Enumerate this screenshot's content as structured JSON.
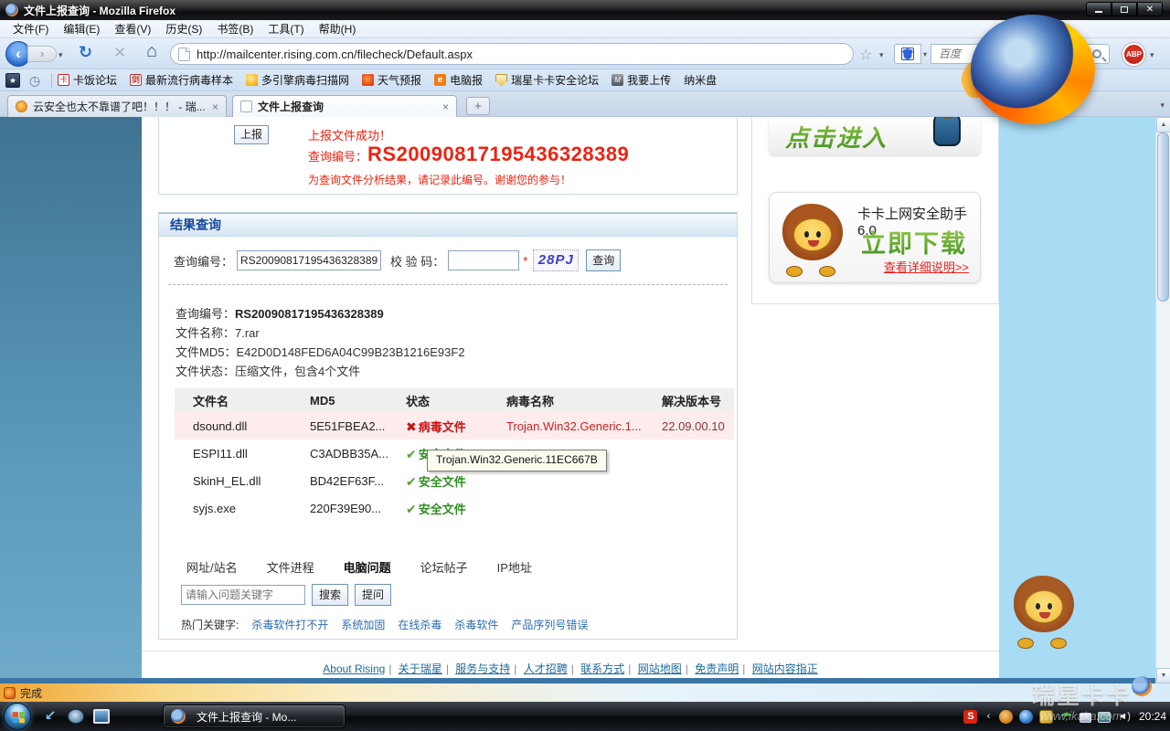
{
  "window": {
    "title": "文件上报查询 - Mozilla Firefox"
  },
  "menu": {
    "items": [
      "文件(F)",
      "编辑(E)",
      "查看(V)",
      "历史(S)",
      "书签(B)",
      "工具(T)",
      "帮助(H)"
    ]
  },
  "nav": {
    "url": "http://mailcenter.rising.com.cn/filecheck/Default.aspx",
    "search_placeholder": "百度",
    "adblock_label": "ABP"
  },
  "bookmarks": {
    "items": [
      "卡饭论坛",
      "最新流行病毒样本",
      "多引擎病毒扫描网",
      "天气预报",
      "电脑报",
      "瑞星卡卡安全论坛",
      "我要上传",
      "纳米盘"
    ]
  },
  "tabs": [
    {
      "label": "云安全也太不靠谱了吧！！！ - 瑞..."
    },
    {
      "label": "文件上报查询"
    }
  ],
  "report": {
    "button": "上报",
    "success": "上报文件成功！",
    "query_label": "查询编号：",
    "query_number": "RS20090817195436328389",
    "note": "为查询文件分析结果，请记录此编号。谢谢您的参与！"
  },
  "result": {
    "section_title": "结果查询",
    "query_label": "查询编号：",
    "query_value": "RS20090817195436328389",
    "captcha_label": "校 验 码：",
    "captcha_required": "*",
    "captcha_code": "28PJ",
    "query_button": "查询",
    "file_info": [
      {
        "label": "查询编号：",
        "value": "RS20090817195436328389"
      },
      {
        "label": "文件名称：",
        "value": "7.rar"
      },
      {
        "label": "文件MD5：",
        "value": "E42D0D148FED6A04C99B23B1216E93F2"
      },
      {
        "label": "文件状态：",
        "value": "压缩文件，包含4个文件"
      }
    ],
    "table": {
      "headers": [
        "文件名",
        "MD5",
        "状态",
        "病毒名称",
        "解决版本号"
      ],
      "rows": [
        {
          "file": "dsound.dll",
          "md5": "5E51FBEA2...",
          "status": "病毒文件",
          "virus": "Trojan.Win32.Generic.1...",
          "version": "22.09.00.10"
        },
        {
          "file": "ESPI11.dll",
          "md5": "C3ADBB35A...",
          "status": "安全文件",
          "virus": "",
          "version": ""
        },
        {
          "file": "SkinH_EL.dll",
          "md5": "BD42EF63F...",
          "status": "安全文件",
          "virus": "",
          "version": ""
        },
        {
          "file": "syjs.exe",
          "md5": "220F39E90...",
          "status": "安全文件",
          "virus": "",
          "version": ""
        }
      ]
    },
    "tooltip": "Trojan.Win32.Generic.11EC667B"
  },
  "help": {
    "tabs": [
      "网址/站名",
      "文件进程",
      "电脑问题",
      "论坛帖子",
      "IP地址"
    ],
    "search_placeholder": "请输入问题关键字",
    "search_button": "搜索",
    "ask_button": "提问",
    "hot_label": "热门关键字:",
    "hot_keywords": [
      "杀毒软件打不开",
      "系统加固",
      "在线杀毒",
      "杀毒软件",
      "产品序列号错误"
    ]
  },
  "sidebar": {
    "banner1_text": "点击进入",
    "banner2_title": "卡卡上网安全助手6.0",
    "banner2_download": "立即下载",
    "banner2_detail": "查看详细说明>>"
  },
  "footer": {
    "links": [
      "About Rising",
      "关于瑞星",
      "服务与支持",
      "人才招聘",
      "联系方式",
      "网站地图",
      "免责声明",
      "网站内容指正"
    ]
  },
  "statusbar": {
    "text": "完成"
  },
  "taskbar": {
    "task": "文件上报查询 - Mo...",
    "clock": "20:24"
  },
  "watermark": {
    "line1": "瑞星卡卡",
    "line2": "www.ikaka.com"
  },
  "icons": {
    "back": "‹",
    "forward": "›",
    "refresh": "↻",
    "stop": "✕",
    "home": "⌂",
    "star": "☆",
    "caret": "▾",
    "new_tab": "+",
    "close_tab": "×",
    "all_tabs": "▾",
    "panel": "★",
    "clock": "◷",
    "virus_mark": "✖",
    "safe_mark": "✔",
    "scroll_up": "▲",
    "scroll_down": "▼",
    "tray_expand": "‹",
    "sogou": "S",
    "umbrella": "☂",
    "volume": "◀)",
    "minimize": "",
    "diannao": "e",
    "upload_m": "M",
    "kafan": "卡",
    "virus_sample": "剑"
  }
}
